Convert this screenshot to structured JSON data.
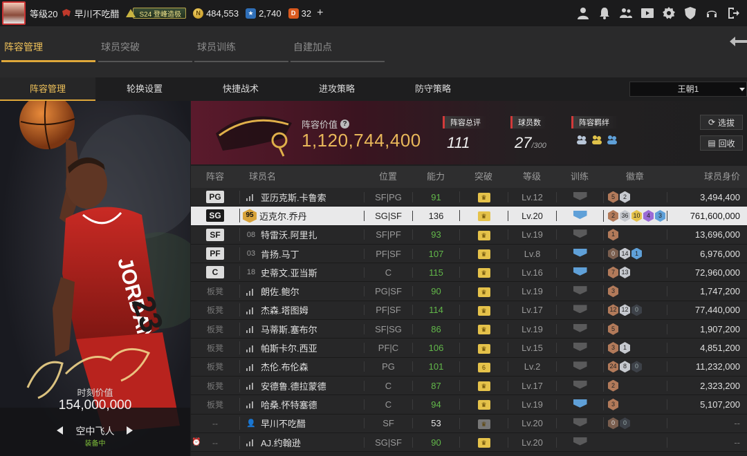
{
  "topbar": {
    "level": "等级20",
    "username": "早川不吃醋",
    "season_badge": "S24 登峰造极",
    "gold": "484,553",
    "stars": "2,740",
    "tokens": "32",
    "plus": "+"
  },
  "main_tabs": [
    "阵容管理",
    "球员突破",
    "球员训练",
    "自建加点"
  ],
  "sub_tabs": [
    "阵容管理",
    "轮换设置",
    "快捷战术",
    "进攻策略",
    "防守策略"
  ],
  "lineup_select": "王朝1",
  "card": {
    "moment_label": "时刻价值",
    "moment_value": "154,000,000",
    "skin_name": "空中飞人",
    "equipped": "装备中"
  },
  "team": {
    "value_label": "阵容价值",
    "value": "1,120,744,400",
    "overall_label": "阵容总评",
    "overall": "111",
    "players_label": "球员数",
    "players": "27",
    "players_max": "/300",
    "chem_label": "阵容羁绊",
    "draft_button": "选拔",
    "recycle_button": "回收"
  },
  "columns": [
    "阵容",
    "球员名",
    "位置",
    "能力",
    "突破",
    "等级",
    "训练",
    "徽章",
    "球员身价"
  ],
  "rows": [
    {
      "slot": "PG",
      "starter": true,
      "num": "sig",
      "name": "亚历克斯.卡鲁索",
      "position": "SF|PG",
      "ovr": "91",
      "ovr_color": "green",
      "brk": "crown",
      "lv": "Lv.12",
      "trn": "grey",
      "badges": [
        [
          "5",
          "bronze"
        ],
        [
          "2",
          "silver"
        ]
      ],
      "salary": "3,494,400"
    },
    {
      "slot": "SG",
      "starter": true,
      "selected": true,
      "num": "95",
      "name": "迈克尔.乔丹",
      "position": "SG|SF",
      "ovr": "136",
      "ovr_color": "white",
      "brk": "crown",
      "lv": "Lv.20",
      "trn": "blue",
      "badges": [
        [
          "2",
          "bronze"
        ],
        [
          "36",
          "silver"
        ],
        [
          "10",
          "gold"
        ],
        [
          "4",
          "purple"
        ],
        [
          "3",
          "blue"
        ]
      ],
      "salary": "761,600,000"
    },
    {
      "slot": "SF",
      "starter": true,
      "num": "08",
      "name": "特雷沃.阿里扎",
      "position": "SF|PF",
      "ovr": "93",
      "ovr_color": "green",
      "brk": "crown",
      "lv": "Lv.19",
      "trn": "grey",
      "badges": [
        [
          "1",
          "bronze"
        ]
      ],
      "salary": "13,696,000"
    },
    {
      "slot": "PF",
      "starter": true,
      "num": "03",
      "name": "肯扬.马丁",
      "position": "PF|SF",
      "ovr": "107",
      "ovr_color": "green",
      "brk": "crown",
      "lv": "Lv.8",
      "trn": "blue",
      "badges": [
        [
          "0",
          "brown"
        ],
        [
          "14",
          "silver"
        ],
        [
          "1",
          "blue"
        ]
      ],
      "salary": "6,976,000"
    },
    {
      "slot": "C",
      "starter": true,
      "num": "18",
      "name": "史蒂文.亚当斯",
      "position": "C",
      "ovr": "115",
      "ovr_color": "green",
      "brk": "crown",
      "lv": "Lv.16",
      "trn": "blue",
      "badges": [
        [
          "7",
          "bronze"
        ],
        [
          "13",
          "silver"
        ]
      ],
      "salary": "72,960,000"
    },
    {
      "slot": "板凳",
      "starter": false,
      "num": "sig",
      "name": "朗佐.鲍尔",
      "position": "PG|SF",
      "ovr": "90",
      "ovr_color": "green",
      "brk": "crown",
      "lv": "Lv.19",
      "trn": "grey",
      "badges": [
        [
          "3",
          "bronze"
        ]
      ],
      "salary": "1,747,200"
    },
    {
      "slot": "板凳",
      "starter": false,
      "num": "sig",
      "name": "杰森.塔图姆",
      "position": "PF|SF",
      "ovr": "114",
      "ovr_color": "green",
      "brk": "crown",
      "lv": "Lv.17",
      "trn": "grey",
      "badges": [
        [
          "12",
          "bronze"
        ],
        [
          "12",
          "silver"
        ],
        [
          "0",
          "dark"
        ]
      ],
      "salary": "77,440,000"
    },
    {
      "slot": "板凳",
      "starter": false,
      "num": "sig",
      "name": "马蒂斯.塞布尔",
      "position": "SF|SG",
      "ovr": "86",
      "ovr_color": "green",
      "brk": "crown",
      "lv": "Lv.19",
      "trn": "grey",
      "badges": [
        [
          "5",
          "bronze"
        ]
      ],
      "salary": "1,907,200"
    },
    {
      "slot": "板凳",
      "starter": false,
      "num": "sig",
      "name": "帕斯卡尔.西亚",
      "position": "PF|C",
      "ovr": "106",
      "ovr_color": "green",
      "brk": "crown",
      "lv": "Lv.15",
      "trn": "grey",
      "badges": [
        [
          "3",
          "bronze"
        ],
        [
          "1",
          "silver"
        ]
      ],
      "salary": "4,851,200"
    },
    {
      "slot": "板凳",
      "starter": false,
      "num": "sig",
      "name": "杰伦.布伦森",
      "position": "PG",
      "ovr": "101",
      "ovr_color": "green",
      "brk": "6",
      "lv": "Lv.2",
      "trn": "grey",
      "badges": [
        [
          "24",
          "bronze"
        ],
        [
          "8",
          "silver"
        ],
        [
          "0",
          "dark"
        ]
      ],
      "salary": "11,232,000"
    },
    {
      "slot": "板凳",
      "starter": false,
      "num": "sig",
      "name": "安德鲁.德拉蒙德",
      "position": "C",
      "ovr": "87",
      "ovr_color": "green",
      "brk": "crown",
      "lv": "Lv.17",
      "trn": "grey",
      "badges": [
        [
          "2",
          "bronze"
        ]
      ],
      "salary": "2,323,200"
    },
    {
      "slot": "板凳",
      "starter": false,
      "num": "sig",
      "name": "哈桑.怀特塞德",
      "position": "C",
      "ovr": "94",
      "ovr_color": "green",
      "brk": "crown",
      "lv": "Lv.19",
      "trn": "blue",
      "badges": [
        [
          "3",
          "bronze"
        ]
      ],
      "salary": "5,107,200"
    },
    {
      "slot": "--",
      "starter": false,
      "num": "user",
      "name": "早川不吃醋",
      "position": "SF",
      "ovr": "53",
      "ovr_color": "white",
      "brk": "grey",
      "lv": "Lv.20",
      "trn": "grey",
      "badges": [
        [
          "0",
          "brown"
        ],
        [
          "0",
          "dark"
        ]
      ],
      "salary": "--"
    },
    {
      "slot": "--",
      "starter": false,
      "num": "sig",
      "name": "AJ.约翰逊",
      "position": "SG|SF",
      "ovr": "90",
      "ovr_color": "green",
      "brk": "crown",
      "lv": "Lv.20",
      "trn": "grey",
      "badges": [],
      "salary": "--",
      "alarm": true
    }
  ]
}
